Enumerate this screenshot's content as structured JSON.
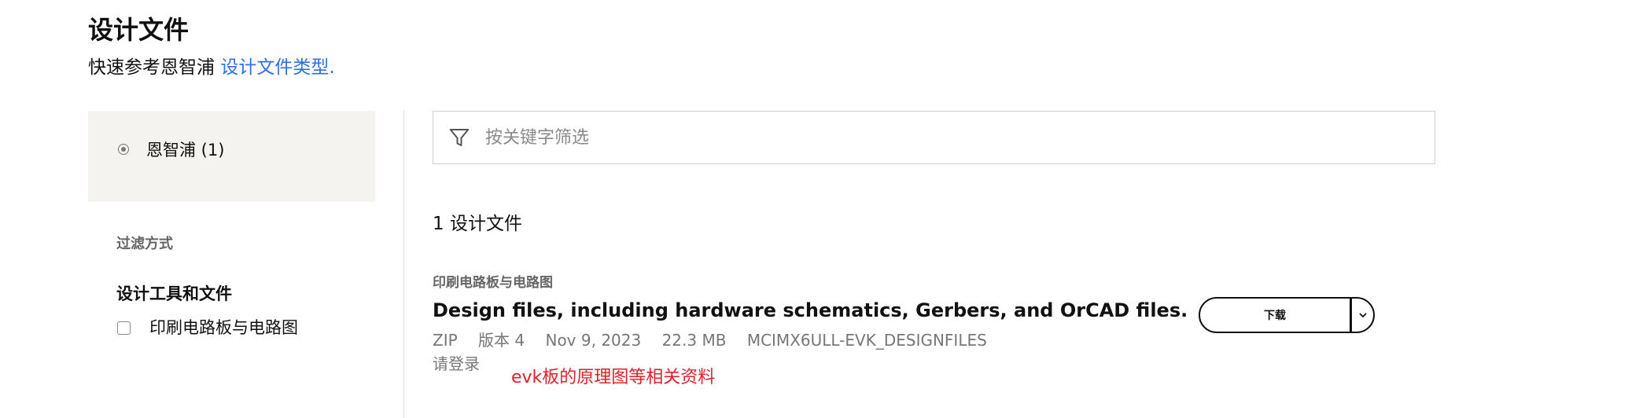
{
  "header": {
    "title": "设计文件",
    "subtitle_prefix": "快速参考恩智浦 ",
    "subtitle_link": "设计文件类型."
  },
  "sidebar": {
    "vendor": {
      "label": "恩智浦 (1)",
      "selected": true
    },
    "filter_heading": "过滤方式",
    "tools_heading": "设计工具和文件",
    "filters": [
      {
        "label": "印刷电路板与电路图",
        "checked": false
      }
    ]
  },
  "search": {
    "placeholder": "按关键字筛选",
    "value": "",
    "icon": "funnel-icon"
  },
  "results": {
    "count_text": "1 设计文件",
    "items": [
      {
        "category": "印刷电路板与电路图",
        "title": "Design files, including hardware schematics, Gerbers, and OrCAD files.",
        "format": "ZIP",
        "version": "版本 4",
        "date": "Nov 9, 2023",
        "size": "22.3 MB",
        "id": "MCIMX6ULL-EVK_DESIGNFILES",
        "login_text": "请登录",
        "download_label": "下载"
      }
    ]
  },
  "annotation": {
    "text": "evk板的原理图等相关资料",
    "color": "#e0202a"
  },
  "colors": {
    "link": "#2f6fde",
    "panel_bg": "#f4f3ef",
    "border": "#cfcfcf"
  }
}
